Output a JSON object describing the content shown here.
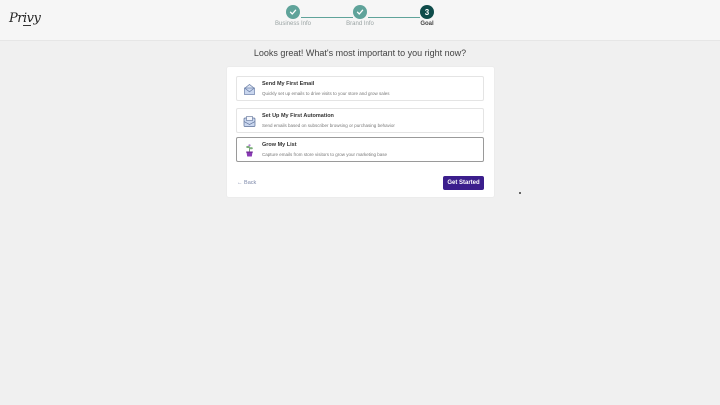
{
  "app": {
    "logo_text": "Privy"
  },
  "stepper": {
    "steps": [
      {
        "label": "Business Info",
        "state": "done",
        "badge": ""
      },
      {
        "label": "Brand Info",
        "state": "done",
        "badge": ""
      },
      {
        "label": "Goal",
        "state": "current",
        "badge": "3"
      }
    ]
  },
  "main": {
    "heading": "Looks great! What's most important to you right now?",
    "options": [
      {
        "title": "Send My First Email",
        "description": "Quickly set up emails to drive visits to your store and grow sales",
        "icon": "envelope-icon",
        "selected": false
      },
      {
        "title": "Set Up My First Automation",
        "description": "Send emails based on subscriber browsing or purchasing behavior",
        "icon": "mailbox-icon",
        "selected": false
      },
      {
        "title": "Grow My List",
        "description": "Capture emails from store visitors to grow your marketing base",
        "icon": "potted-plant-icon",
        "selected": true
      }
    ],
    "back_label": "← Back",
    "cta_label": "Get Started"
  },
  "colors": {
    "step_done": "#5fa39a",
    "step_current": "#0f4c4a",
    "cta": "#3b1e8c",
    "back_link": "#7a86a8"
  }
}
